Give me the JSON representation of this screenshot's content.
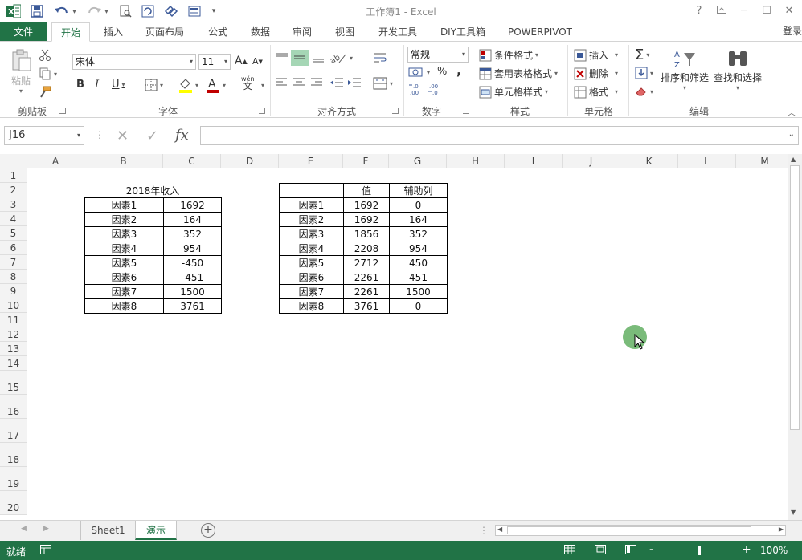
{
  "window": {
    "title": "工作簿1 - Excel",
    "app_icon": "X"
  },
  "tabs": {
    "file": "文件",
    "items": [
      "开始",
      "插入",
      "页面布局",
      "公式",
      "数据",
      "审阅",
      "视图",
      "开发工具",
      "DIY工具箱",
      "POWERPIVOT"
    ],
    "active": "开始",
    "login": "登录"
  },
  "ribbon": {
    "clipboard": {
      "label": "剪贴板",
      "paste": "粘贴"
    },
    "font": {
      "label": "字体",
      "name": "宋体",
      "size": "11",
      "bold": "B",
      "italic": "I",
      "underline": "U",
      "grow": "A",
      "shrink": "A",
      "phonetic": "wén"
    },
    "alignment": {
      "label": "对齐方式"
    },
    "number": {
      "label": "数字",
      "format": "常规",
      "percent": "%",
      "comma": ","
    },
    "styles": {
      "label": "样式",
      "conditional": "条件格式",
      "table": "套用表格格式",
      "cell": "单元格样式"
    },
    "cells": {
      "label": "单元格",
      "insert": "插入",
      "delete": "删除",
      "format": "格式"
    },
    "editing": {
      "label": "编辑",
      "sort": "排序和筛选",
      "find": "查找和选择"
    }
  },
  "formula_bar": {
    "name_box": "J16",
    "fx": "fx",
    "value": ""
  },
  "columns": [
    "A",
    "B",
    "C",
    "D",
    "E",
    "F",
    "G",
    "H",
    "I",
    "J",
    "K",
    "L",
    "M"
  ],
  "rows": [
    "1",
    "2",
    "3",
    "4",
    "5",
    "6",
    "7",
    "8",
    "9",
    "10",
    "11",
    "12",
    "13",
    "14",
    "15",
    "16",
    "17",
    "18",
    "19",
    "20"
  ],
  "table1": {
    "title": "2018年收入",
    "rows": [
      [
        "因素1",
        "1692"
      ],
      [
        "因素2",
        "164"
      ],
      [
        "因素3",
        "352"
      ],
      [
        "因素4",
        "954"
      ],
      [
        "因素5",
        "-450"
      ],
      [
        "因素6",
        "-451"
      ],
      [
        "因素7",
        "1500"
      ],
      [
        "因素8",
        "3761"
      ]
    ]
  },
  "table2": {
    "headers": [
      "",
      "值",
      "辅助列"
    ],
    "rows": [
      [
        "因素1",
        "1692",
        "0"
      ],
      [
        "因素2",
        "1692",
        "164"
      ],
      [
        "因素3",
        "1856",
        "352"
      ],
      [
        "因素4",
        "2208",
        "954"
      ],
      [
        "因素5",
        "2712",
        "450"
      ],
      [
        "因素6",
        "2261",
        "451"
      ],
      [
        "因素7",
        "2261",
        "1500"
      ],
      [
        "因素8",
        "3761",
        "0"
      ]
    ]
  },
  "sheets": {
    "items": [
      "Sheet1",
      "演示"
    ],
    "active": "演示"
  },
  "status": {
    "ready": "就绪",
    "zoom": "100%",
    "minus": "-",
    "plus": "+"
  },
  "colors": {
    "accent": "#217346"
  }
}
